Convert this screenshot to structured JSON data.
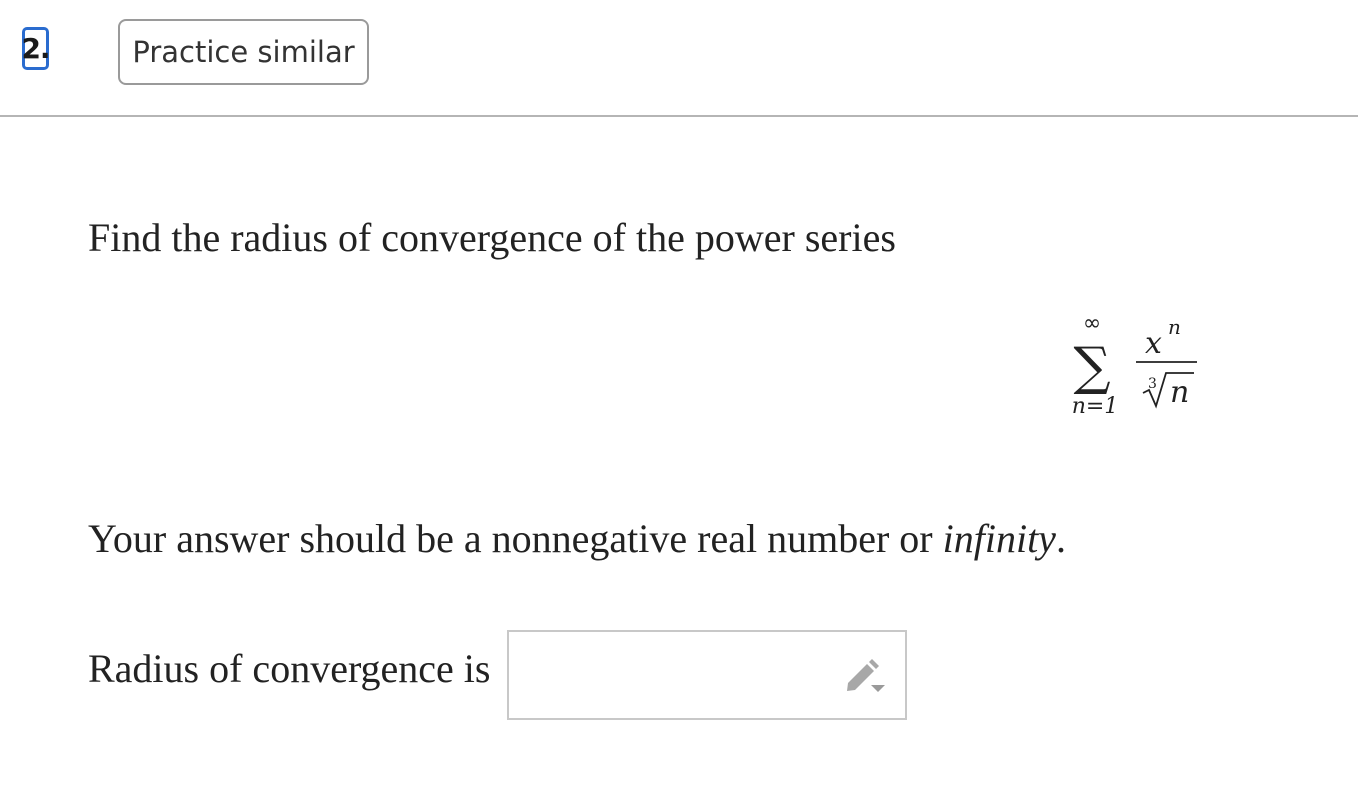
{
  "header": {
    "question_number": "2.",
    "practice_button_label": "Practice similar"
  },
  "question": {
    "prompt": "Find the radius of convergence of the power series",
    "series": {
      "sum_symbol": "∑",
      "upper_limit": "∞",
      "lower_limit": "n=1",
      "numerator_base": "x",
      "numerator_exponent": "n",
      "root_index": "3",
      "radicand": "n"
    },
    "instruction_text": "Your answer should be a nonnegative real number or ",
    "instruction_emphasis": "infinity",
    "instruction_end": "."
  },
  "answer": {
    "label": "Radius of convergence is",
    "value": "",
    "placeholder": "",
    "edit_icon": "pencil-icon"
  },
  "colors": {
    "focus_border": "#2a6ccf",
    "button_border": "#9a9a9a",
    "divider": "#b5b5b5",
    "input_border": "#c8c8c8"
  }
}
